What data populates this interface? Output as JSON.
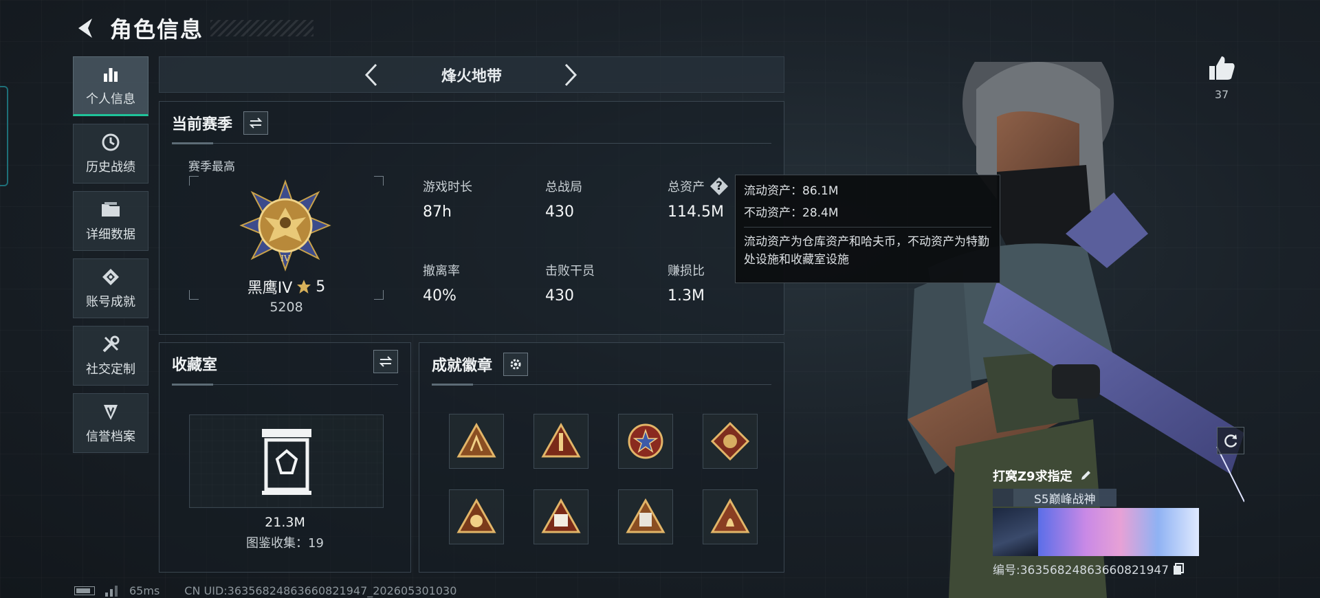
{
  "header": {
    "title": "角色信息"
  },
  "nav": {
    "items": [
      {
        "label": "个人信息",
        "icon": "bar-chart-icon",
        "active": true
      },
      {
        "label": "历史战绩",
        "icon": "history-icon",
        "active": false
      },
      {
        "label": "详细数据",
        "icon": "folder-icon",
        "active": false
      },
      {
        "label": "账号成就",
        "icon": "achievement-icon",
        "active": false
      },
      {
        "label": "社交定制",
        "icon": "tools-icon",
        "active": false
      },
      {
        "label": "信誉档案",
        "icon": "credit-icon",
        "active": false
      }
    ]
  },
  "season_selector": {
    "name": "烽火地带"
  },
  "current_season": {
    "title": "当前赛季",
    "best_label": "赛季最高",
    "rank": {
      "name": "黑鹰IV",
      "stars": "5",
      "score": "5208"
    },
    "stats": [
      {
        "label": "游戏时长",
        "value": "87h"
      },
      {
        "label": "总战局",
        "value": "430"
      },
      {
        "label": "总资产",
        "value": "114.5M",
        "has_help": true
      },
      {
        "label": "撤离率",
        "value": "40%"
      },
      {
        "label": "击败干员",
        "value": "430"
      },
      {
        "label": "赚损比",
        "value": "1.3M"
      }
    ]
  },
  "tooltip": {
    "liquid": "流动资产：86.1M",
    "fixed": "不动资产：28.4M",
    "description": "流动资产为仓库资产和哈夫币，不动资产为特勤处设施和收藏室设施"
  },
  "collection": {
    "title": "收藏室",
    "value": "21.3M",
    "count_label": "图鉴收集：19"
  },
  "achievements": {
    "title": "成就徽章",
    "badges": [
      "badge-icon",
      "badge-icon",
      "badge-icon",
      "badge-icon",
      "badge-icon",
      "badge-icon",
      "badge-icon",
      "badge-icon"
    ]
  },
  "likes": {
    "count": "37"
  },
  "player": {
    "name": "打窝Z9求指定",
    "title": "S5巅峰战神",
    "uid_line": "编号:36356824863660821947"
  },
  "status_bar": {
    "ping": "65ms",
    "uid": "CN UID:36356824863660821947_202605301030"
  },
  "colors": {
    "accent": "#1fc49a",
    "panel_border": "#3a4650",
    "background": "#1a2128"
  }
}
